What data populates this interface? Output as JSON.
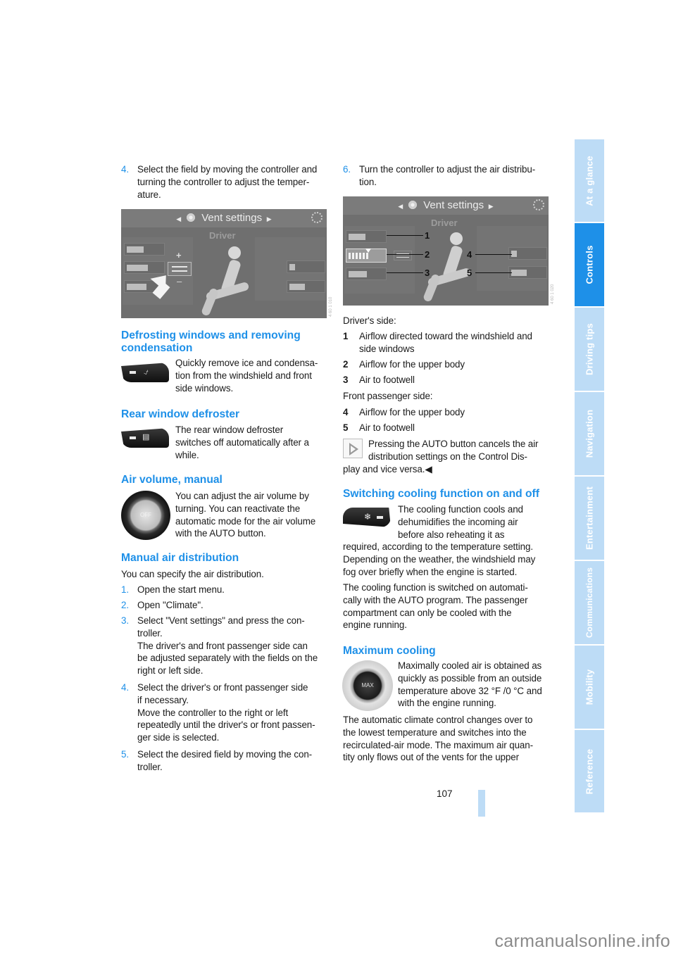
{
  "page": {
    "number": "107",
    "watermark": "carmanualsonline.info"
  },
  "side_tabs": [
    {
      "label": "At a glance",
      "active": false
    },
    {
      "label": "Controls",
      "active": true
    },
    {
      "label": "Driving tips",
      "active": false
    },
    {
      "label": "Navigation",
      "active": false
    },
    {
      "label": "Entertainment",
      "active": false
    },
    {
      "label": "Communications",
      "active": false
    },
    {
      "label": "Mobility",
      "active": false
    },
    {
      "label": "Reference",
      "active": false
    }
  ],
  "left": {
    "step4": {
      "num": "4.",
      "lines": [
        "Select the field by moving the controller and",
        "turning the controller to adjust the temper-",
        "ature."
      ]
    },
    "screen1": {
      "title": "Vent settings",
      "subtitle": "Driver",
      "plus": "+",
      "minus": "–"
    },
    "defrost": {
      "heading_lines": [
        "Defrosting windows and removing",
        "condensation"
      ],
      "text_lines": [
        "Quickly remove ice and condensa-",
        "tion from the windshield and front",
        "side windows."
      ]
    },
    "rear": {
      "heading": "Rear window defroster",
      "text_lines": [
        "The rear window defroster",
        "switches off automatically after a",
        "while."
      ]
    },
    "air_volume": {
      "heading": "Air volume, manual",
      "dial_label": "OFF",
      "text_lines": [
        "You can adjust the air volume by",
        "turning. You can reactivate the",
        "automatic mode for the air volume",
        "with the AUTO button."
      ]
    },
    "manual_dist": {
      "heading": "Manual air distribution",
      "intro": "You can specify the air distribution.",
      "steps": [
        {
          "num": "1.",
          "lines": [
            "Open the start menu."
          ]
        },
        {
          "num": "2.",
          "lines": [
            "Open \"Climate\"."
          ]
        },
        {
          "num": "3.",
          "lines": [
            "Select \"Vent settings\" and press the con-",
            "troller.",
            "The driver's and front passenger side can",
            "be adjusted separately with the fields on the",
            "right or left side."
          ]
        },
        {
          "num": "4.",
          "lines": [
            "Select the driver's or front passenger side",
            "if necessary.",
            "Move the controller to the right or left",
            "repeatedly until the driver's or front passen-",
            "ger side is selected."
          ]
        },
        {
          "num": "5.",
          "lines": [
            "Select the desired field by moving the con-",
            "troller."
          ]
        }
      ]
    }
  },
  "right": {
    "step6": {
      "num": "6.",
      "lines": [
        "Turn the controller to adjust the air distribu-",
        "tion."
      ]
    },
    "screen2": {
      "title": "Vent settings",
      "subtitle": "Driver",
      "callouts": [
        "1",
        "2",
        "3",
        "4",
        "5"
      ]
    },
    "drivers_side_label": "Driver's side:",
    "drivers_items": [
      {
        "num": "1",
        "lines": [
          "Airflow directed toward the windshield and",
          "side windows"
        ]
      },
      {
        "num": "2",
        "lines": [
          "Airflow for the upper body"
        ]
      },
      {
        "num": "3",
        "lines": [
          "Air to footwell"
        ]
      }
    ],
    "passenger_side_label": "Front passenger side:",
    "passenger_items": [
      {
        "num": "4",
        "lines": [
          "Airflow for the upper body"
        ]
      },
      {
        "num": "5",
        "lines": [
          "Air to footwell"
        ]
      }
    ],
    "note_lines": [
      "Pressing the AUTO button cancels the air",
      "distribution settings on the Control Dis-",
      "play and vice versa.◀"
    ],
    "cooling": {
      "heading": "Switching cooling function on and off",
      "text_lines": [
        "The cooling function cools and",
        "dehumidifies the incoming air",
        "before also reheating it as",
        "required, according to the temperature setting.",
        "Depending on the weather, the windshield may",
        "fog over briefly when the engine is started."
      ],
      "para2_lines": [
        "The cooling function is switched on automati-",
        "cally with the AUTO program. The passenger",
        "compartment can only be cooled with the",
        "engine running."
      ]
    },
    "max_cooling": {
      "heading": "Maximum cooling",
      "dial_label": "MAX",
      "text_lines": [
        "Maximally cooled air is obtained as",
        "quickly as possible from an outside",
        "temperature above 32 °F /0 °C and",
        "with the engine running."
      ],
      "para2_lines": [
        "The automatic climate control changes over to",
        "the lowest temperature and switches into the",
        "recirculated-air mode. The maximum air quan-",
        "tity only flows out of the vents for the upper"
      ]
    }
  }
}
